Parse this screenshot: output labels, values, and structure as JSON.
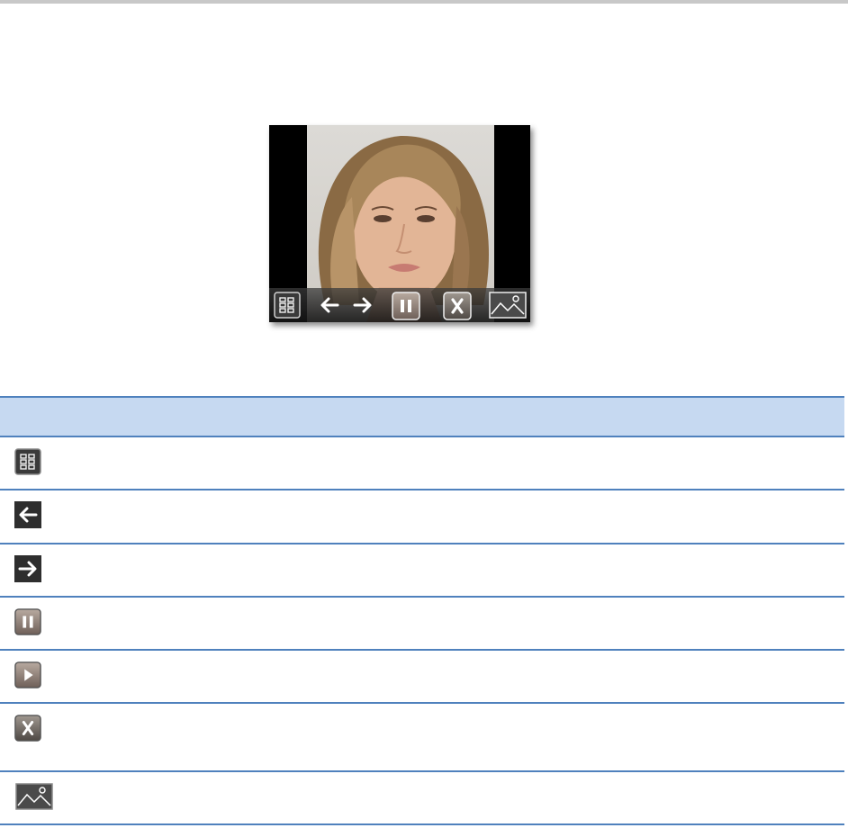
{
  "figure": {
    "alt": "",
    "toolbar_buttons": [
      {
        "icon": "thumbnails-icon"
      },
      {
        "icon": "previous-arrow-icon"
      },
      {
        "icon": "next-arrow-icon"
      },
      {
        "icon": "pause-icon"
      },
      {
        "icon": "close-x-icon"
      },
      {
        "icon": "fit-image-icon"
      }
    ]
  },
  "legend": {
    "header": "",
    "rows": [
      {
        "icon": "thumbnails-icon",
        "text": ""
      },
      {
        "icon": "previous-arrow-icon",
        "text": ""
      },
      {
        "icon": "next-arrow-icon",
        "text": ""
      },
      {
        "icon": "pause-icon",
        "text": ""
      },
      {
        "icon": "play-icon",
        "text": ""
      },
      {
        "icon": "close-x-icon",
        "text": ""
      },
      {
        "icon": "fit-image-icon",
        "text": ""
      }
    ]
  },
  "colors": {
    "header_fill": "#c6d9f1",
    "rule": "#4f81bd",
    "toolbar": "#2a2a2a"
  }
}
